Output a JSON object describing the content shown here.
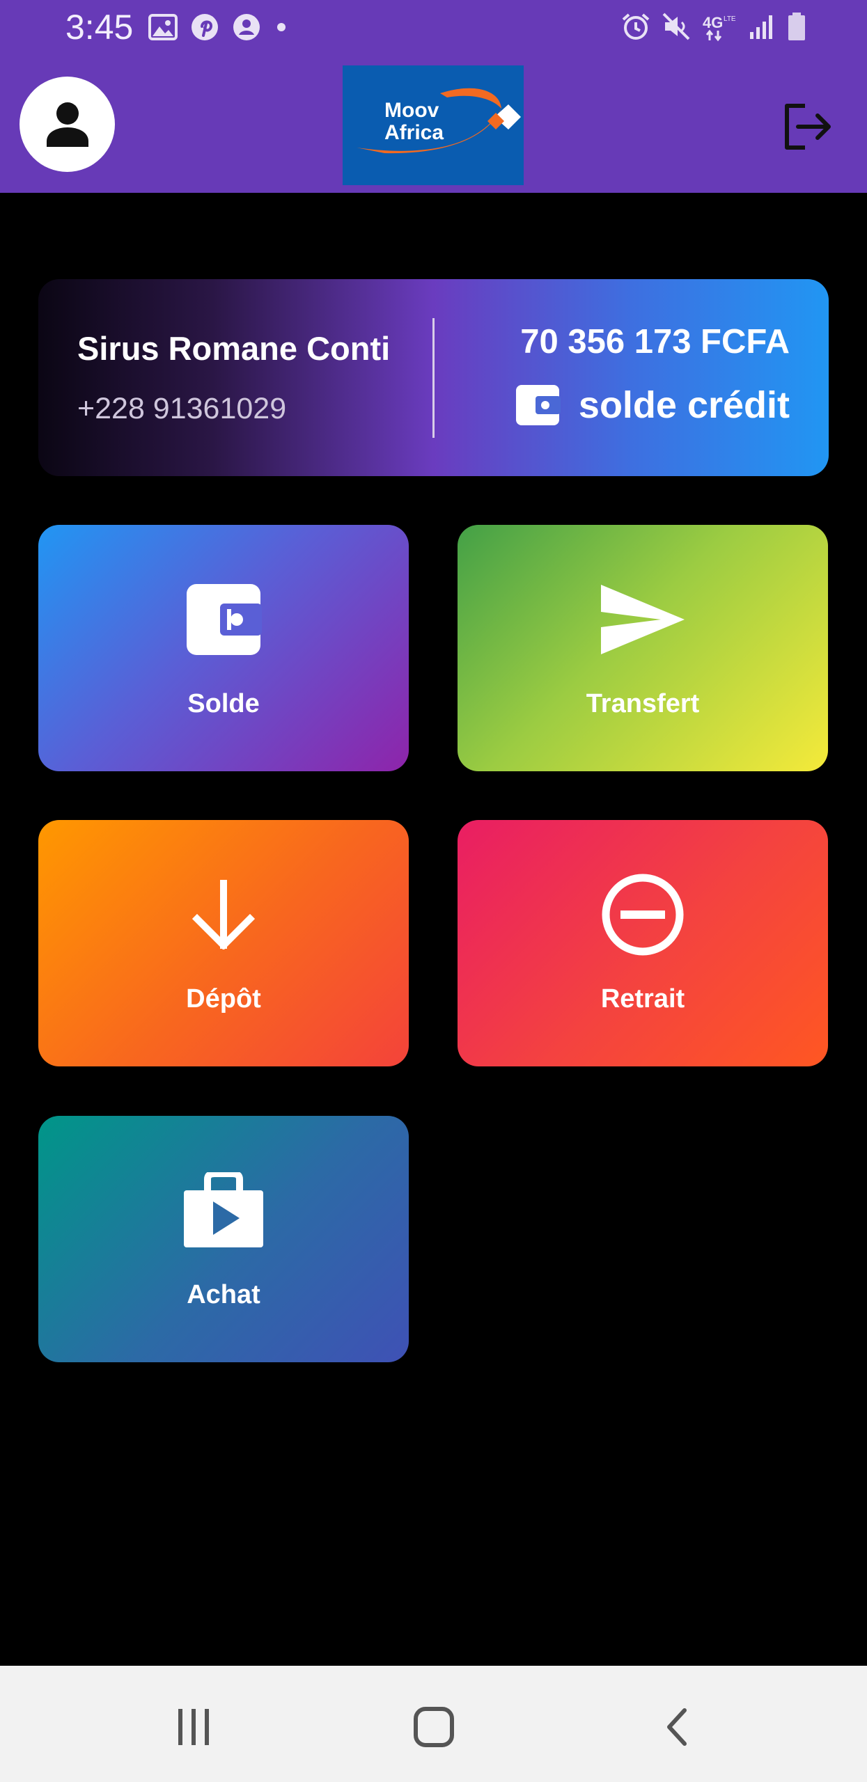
{
  "status_bar": {
    "time": "3:45",
    "left_icons": [
      "gallery-icon",
      "pinterest-icon",
      "account-circle-icon",
      "dot-icon"
    ],
    "right_icons": [
      "alarm-icon",
      "mute-icon",
      "4g-lte-icon",
      "signal-icon",
      "battery-icon"
    ]
  },
  "app_bar": {
    "logo_line1": "Moov",
    "logo_line2": "Africa",
    "avatar_icon": "person-icon",
    "logout_icon": "logout-icon",
    "colors": {
      "bar": "#673ab7",
      "logo_bg": "#0a5cb0",
      "logo_swoosh": "#f26a21"
    }
  },
  "account": {
    "name": "Sirus Romane Conti",
    "phone": "+228 91361029",
    "amount": "70 356 173 FCFA",
    "credit_label": "solde crédit",
    "credit_icon": "wallet-icon"
  },
  "tiles": [
    {
      "label": "Solde",
      "icon": "wallet-icon"
    },
    {
      "label": "Transfert",
      "icon": "send-icon"
    },
    {
      "label": "Dépôt",
      "icon": "arrow-down-icon"
    },
    {
      "label": "Retrait",
      "icon": "minus-circle-icon"
    },
    {
      "label": "Achat",
      "icon": "shop-bag-icon"
    }
  ],
  "nav_bar": {
    "buttons": [
      "recents-icon",
      "home-icon",
      "back-icon"
    ]
  }
}
